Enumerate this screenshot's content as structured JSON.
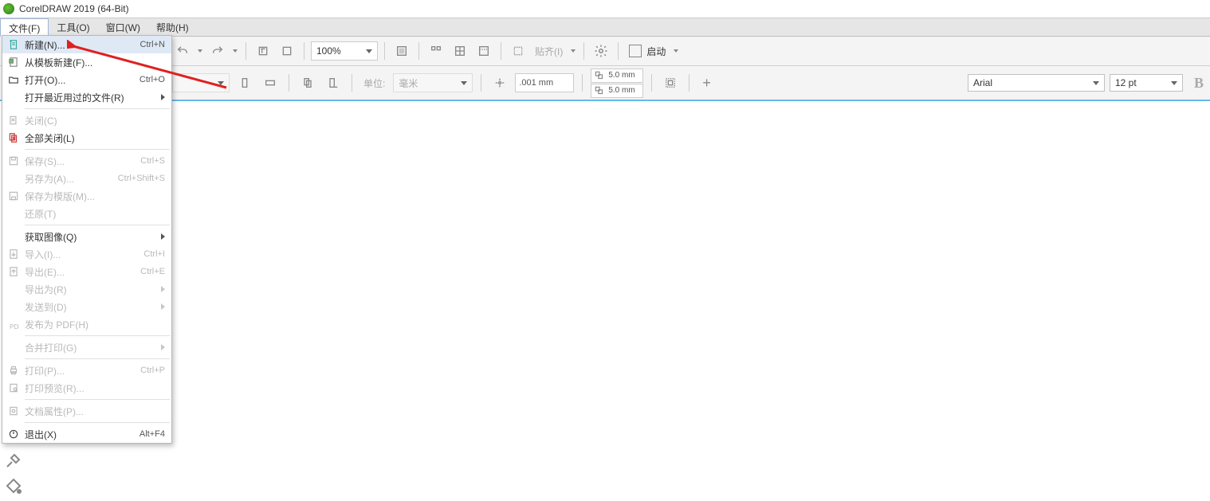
{
  "title": "CorelDRAW 2019 (64-Bit)",
  "menubar": {
    "file": "文件(F)",
    "tools": "工具(O)",
    "window": "窗口(W)",
    "help": "帮助(H)"
  },
  "toolbar": {
    "zoom": "100%",
    "align_label": "贴齐(I)",
    "startup": "启动"
  },
  "propbar": {
    "unit_label": "单位:",
    "unit_value": "毫米",
    "nudge": ".001 mm",
    "dup_x": "5.0 mm",
    "dup_y": "5.0 mm",
    "font_name": "Arial",
    "font_size": "12 pt"
  },
  "file_menu": [
    {
      "id": "new",
      "label": "新建(N)...",
      "short": "Ctrl+N",
      "icon": "new",
      "enabled": true,
      "hover": true
    },
    {
      "id": "new-from-template",
      "label": "从模板新建(F)...",
      "icon": "template",
      "enabled": true
    },
    {
      "id": "open",
      "label": "打开(O)...",
      "short": "Ctrl+O",
      "icon": "open",
      "enabled": true
    },
    {
      "id": "recent",
      "label": "打开最近用过的文件(R)",
      "enabled": true,
      "submenu": true
    },
    {
      "sep": true
    },
    {
      "id": "close",
      "label": "关闭(C)",
      "icon": "close",
      "enabled": false
    },
    {
      "id": "close-all",
      "label": "全部关闭(L)",
      "icon": "close-all",
      "enabled": true
    },
    {
      "sep": true
    },
    {
      "id": "save",
      "label": "保存(S)...",
      "short": "Ctrl+S",
      "icon": "save",
      "enabled": false
    },
    {
      "id": "save-as",
      "label": "另存为(A)...",
      "short": "Ctrl+Shift+S",
      "enabled": false
    },
    {
      "id": "save-tmpl",
      "label": "保存为模版(M)...",
      "icon": "save-tmpl",
      "enabled": false
    },
    {
      "id": "revert",
      "label": "还原(T)",
      "enabled": false
    },
    {
      "sep": true
    },
    {
      "id": "acquire",
      "label": "获取图像(Q)",
      "enabled": true,
      "submenu": true
    },
    {
      "id": "import",
      "label": "导入(I)...",
      "short": "Ctrl+I",
      "icon": "import",
      "enabled": false
    },
    {
      "id": "export",
      "label": "导出(E)...",
      "short": "Ctrl+E",
      "icon": "export",
      "enabled": false
    },
    {
      "id": "export-for",
      "label": "导出为(R)",
      "enabled": false,
      "submenu": true
    },
    {
      "id": "send-to",
      "label": "发送到(D)",
      "enabled": false,
      "submenu": true
    },
    {
      "id": "publish-pdf",
      "label": "发布为 PDF(H)",
      "icon": "pdf",
      "enabled": false
    },
    {
      "sep": true
    },
    {
      "id": "print-merge",
      "label": "合并打印(G)",
      "enabled": false,
      "submenu": true
    },
    {
      "sep": true
    },
    {
      "id": "print",
      "label": "打印(P)...",
      "short": "Ctrl+P",
      "icon": "print",
      "enabled": false
    },
    {
      "id": "print-preview",
      "label": "打印预览(R)...",
      "icon": "preview",
      "enabled": false
    },
    {
      "sep": true
    },
    {
      "id": "doc-props",
      "label": "文档属性(P)...",
      "icon": "props",
      "enabled": false
    },
    {
      "sep": true
    },
    {
      "id": "exit",
      "label": "退出(X)",
      "short": "Alt+F4",
      "icon": "exit",
      "enabled": true
    }
  ]
}
